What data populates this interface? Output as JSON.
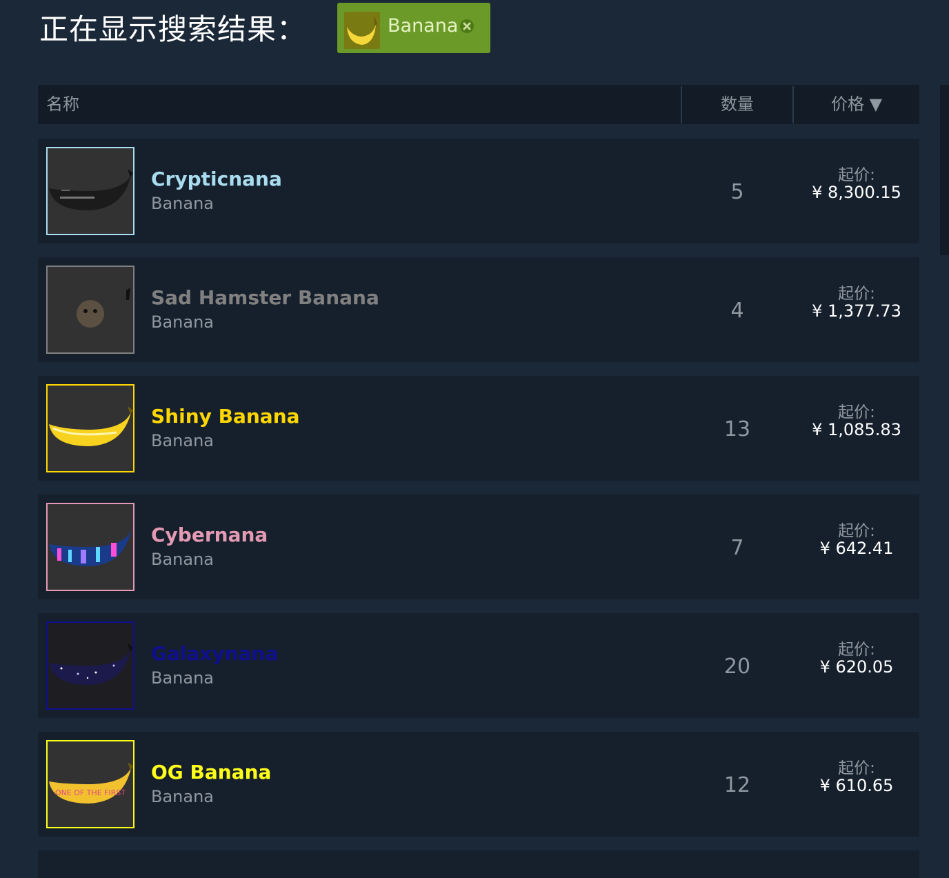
{
  "header": {
    "title": "正在显示搜索结果：",
    "filter_tag": {
      "label": "Banana",
      "close_icon": "close-circle-icon"
    }
  },
  "table": {
    "columns": {
      "name": "名称",
      "quantity": "数量",
      "price": "价格 ▼"
    },
    "rows": [
      {
        "name": "Crypticnana",
        "type": "Banana",
        "quantity": "5",
        "price_label": "起价:",
        "price": "¥ 8,300.15",
        "name_color": "#a8dcee",
        "border_color": "#a8dcee",
        "icon": "black-banana-icon"
      },
      {
        "name": "Sad Hamster Banana",
        "type": "Banana",
        "quantity": "4",
        "price_label": "起价:",
        "price": "¥ 1,377.73",
        "name_color": "#808080",
        "border_color": "#808080",
        "icon": "hamster-banana-icon"
      },
      {
        "name": "Shiny Banana",
        "type": "Banana",
        "quantity": "13",
        "price_label": "起价:",
        "price": "¥ 1,085.83",
        "name_color": "#ffd700",
        "border_color": "#ffd700",
        "icon": "shiny-banana-icon"
      },
      {
        "name": "Cybernana",
        "type": "Banana",
        "quantity": "7",
        "price_label": "起价:",
        "price": "¥ 642.41",
        "name_color": "#e39ab2",
        "border_color": "#e39ab2",
        "icon": "cyber-banana-icon"
      },
      {
        "name": "Galaxynana",
        "type": "Banana",
        "quantity": "20",
        "price_label": "起价:",
        "price": "¥ 620.05",
        "name_color": "#0f0f8c",
        "border_color": "#0f0f8c",
        "icon": "galaxy-banana-icon"
      },
      {
        "name": "OG Banana",
        "type": "Banana",
        "quantity": "12",
        "price_label": "起价:",
        "price": "¥ 610.65",
        "name_color": "#ffff1a",
        "border_color": "#ffff1a",
        "icon": "og-banana-icon",
        "overlay_text": "ONE OF THE FIRST"
      }
    ]
  }
}
